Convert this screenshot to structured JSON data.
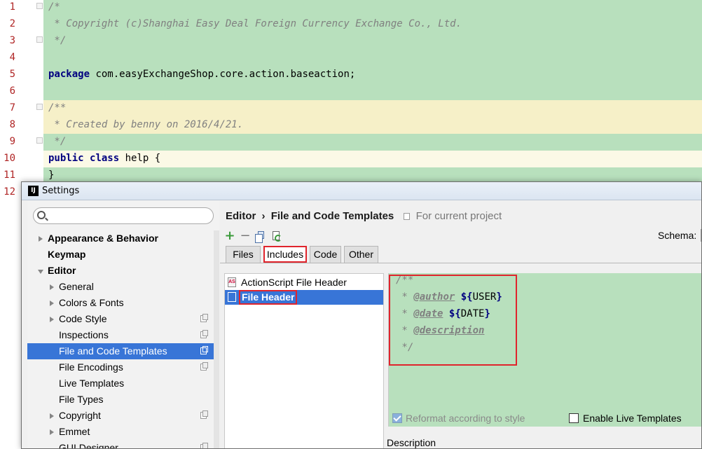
{
  "editor": {
    "line_numbers": [
      "1",
      "2",
      "3",
      "4",
      "5",
      "6",
      "7",
      "8",
      "9",
      "10",
      "11",
      "12"
    ],
    "lines": {
      "l1": "/*",
      "l2": " * Copyright (c)Shanghai Easy Deal Foreign Currency Exchange Co., Ltd.",
      "l3": " */",
      "l5_kw": "package",
      "l5_rest": " com.easyExchangeShop.core.action.baseaction;",
      "l7": "/**",
      "l8": " * Created by benny on 2016/4/21.",
      "l9": " */",
      "l10_kw1": "public",
      "l10_kw2": "class",
      "l10_rest": " help {",
      "l11": "}"
    },
    "colors": {
      "background": "#b8e0bd",
      "comment": "#808080",
      "keyword": "#000080",
      "line_number": "#b02525"
    }
  },
  "dialog": {
    "title": "Settings",
    "title_icon": "IJ",
    "breadcrumb": {
      "parent": "Editor",
      "separator": "›",
      "current": "File and Code Templates",
      "scope": "For current project"
    },
    "schema_label": "Schema:",
    "toolbar": {
      "add": "+",
      "remove": "−"
    },
    "tabs": [
      "Files",
      "Includes",
      "Code",
      "Other"
    ],
    "tree": {
      "appearance": "Appearance & Behavior",
      "keymap": "Keymap",
      "editor": "Editor",
      "general": "General",
      "colors_fonts": "Colors & Fonts",
      "code_style": "Code Style",
      "inspections": "Inspections",
      "file_code_templates": "File and Code Templates",
      "file_encodings": "File Encodings",
      "live_templates": "Live Templates",
      "file_types": "File Types",
      "copyright": "Copyright",
      "emmet": "Emmet",
      "gui_designer": "GUI Designer"
    },
    "files": {
      "actionscript": "ActionScript File Header",
      "actionscript_icon": "AS",
      "file_header": "File Header"
    },
    "template": {
      "l1": "/**",
      "l2_prefix": " * ",
      "l2_tag": "@author",
      "l2_var": "${",
      "l2_name": "USER",
      "l2_end": "}",
      "l3_prefix": " * ",
      "l3_tag": "@date",
      "l3_var": "${",
      "l3_name": "DATE",
      "l3_end": "}",
      "l4_prefix": " * ",
      "l4_tag": "@description",
      "l5": " */"
    },
    "reformat_label": "Reformat according to style",
    "reformat_checked": true,
    "live_templates_label": "Enable Live Templates",
    "live_templates_checked": false,
    "description_label": "Description",
    "colors": {
      "selection": "#3875d7",
      "highlight_box": "#e0242c"
    }
  }
}
